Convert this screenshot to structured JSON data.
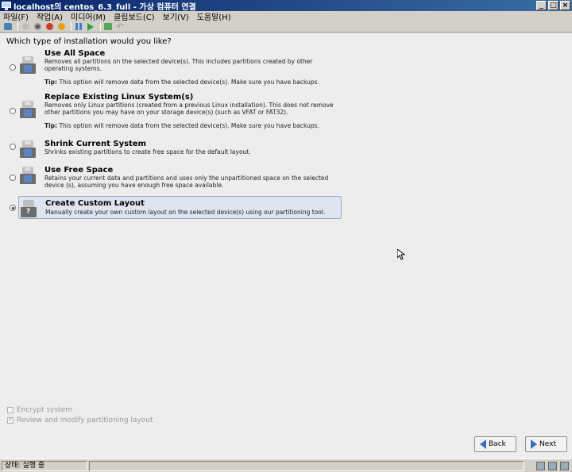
{
  "window": {
    "title": "localhost의 centos_6.3_full - 가상 컴퓨터 연결",
    "min": "_",
    "max": "□",
    "close": "×"
  },
  "menu": {
    "items": [
      "파일(F)",
      "작업(A)",
      "미디어(M)",
      "클립보드(C)",
      "보기(V)",
      "도움말(H)"
    ]
  },
  "toolbar": {
    "icons": [
      "ctrl-alt-del-icon",
      "start-icon",
      "turn-off-icon",
      "shutdown-icon",
      "save-state-icon",
      "pause-icon",
      "reset-icon",
      "snapshot-icon",
      "revert-icon"
    ]
  },
  "installer": {
    "question": "Which type of installation would you like?",
    "options": [
      {
        "title": "Use All Space",
        "desc": "Removes all partitions on the selected device(s).  This includes partitions created by other operating systems.",
        "tip_label": "Tip:",
        "tip": " This option will remove data from the selected device(s).  Make sure you have backups.",
        "selected": false
      },
      {
        "title": "Replace Existing Linux System(s)",
        "desc": "Removes only Linux partitions (created from a previous Linux installation).  This does not remove other partitions you may have on your storage device(s) (such as VFAT or FAT32).",
        "tip_label": "Tip:",
        "tip": " This option will remove data from the selected device(s).  Make sure you have backups.",
        "selected": false
      },
      {
        "title": "Shrink Current System",
        "desc": "Shrinks existing partitions to create free space for the default layout.",
        "selected": false
      },
      {
        "title": "Use Free Space",
        "desc": "Retains your current data and partitions and uses only the unpartitioned space on the selected device (s), assuming you have enough free space available.",
        "selected": false
      },
      {
        "title": "Create Custom Layout",
        "desc": "Manually create your own custom layout on the selected device(s) using our partitioning tool.",
        "selected": true
      }
    ],
    "disk_label": "OS",
    "custom_glyph": "?",
    "encrypt_label": "Encrypt system",
    "encrypt_checked": false,
    "review_label": "Review and modify partitioning layout",
    "review_checked": true,
    "back_label": "Back",
    "next_label": "Next"
  },
  "status": {
    "text": "상태: 실행 중"
  },
  "colors": {
    "titlebar": "#0a246a",
    "selection": "#dfe5f0",
    "accent_blue": "#3a6fc0"
  }
}
